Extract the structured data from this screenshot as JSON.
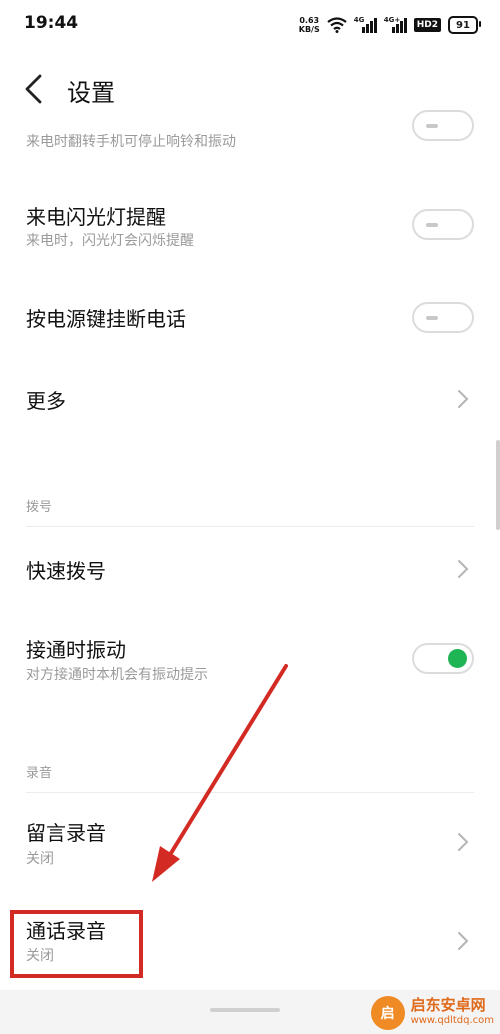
{
  "status_bar": {
    "time": "19:44",
    "net_speed_value": "0.63",
    "net_speed_unit": "KB/S",
    "signal1_tag": "4G",
    "signal2_tag": "4G+",
    "hd_label": "HD2",
    "battery": "91"
  },
  "header": {
    "title": "设置"
  },
  "rows": {
    "flip_mute_sub": "来电时翻转手机可停止响铃和振动",
    "flash_reminder": {
      "title": "来电闪光灯提醒",
      "sub": "来电时，闪光灯会闪烁提醒",
      "enabled": false
    },
    "power_hangup": {
      "title": "按电源键挂断电话",
      "enabled": false
    },
    "more": {
      "title": "更多"
    },
    "dial_section": "拨号",
    "speed_dial": {
      "title": "快速拨号"
    },
    "connect_vibrate": {
      "title": "接通时振动",
      "sub": "对方接通时本机会有振动提示",
      "enabled": true
    },
    "record_section": "录音",
    "voicemail_record": {
      "title": "留言录音",
      "sub": "关闭"
    },
    "call_record": {
      "title": "通话录音",
      "sub": "关闭"
    }
  },
  "watermark": {
    "logo": "启",
    "name": "启东安卓网",
    "url": "www.qdltdq.com"
  },
  "colors": {
    "toggle_on": "#1fb554",
    "annotation": "#d32a24"
  }
}
